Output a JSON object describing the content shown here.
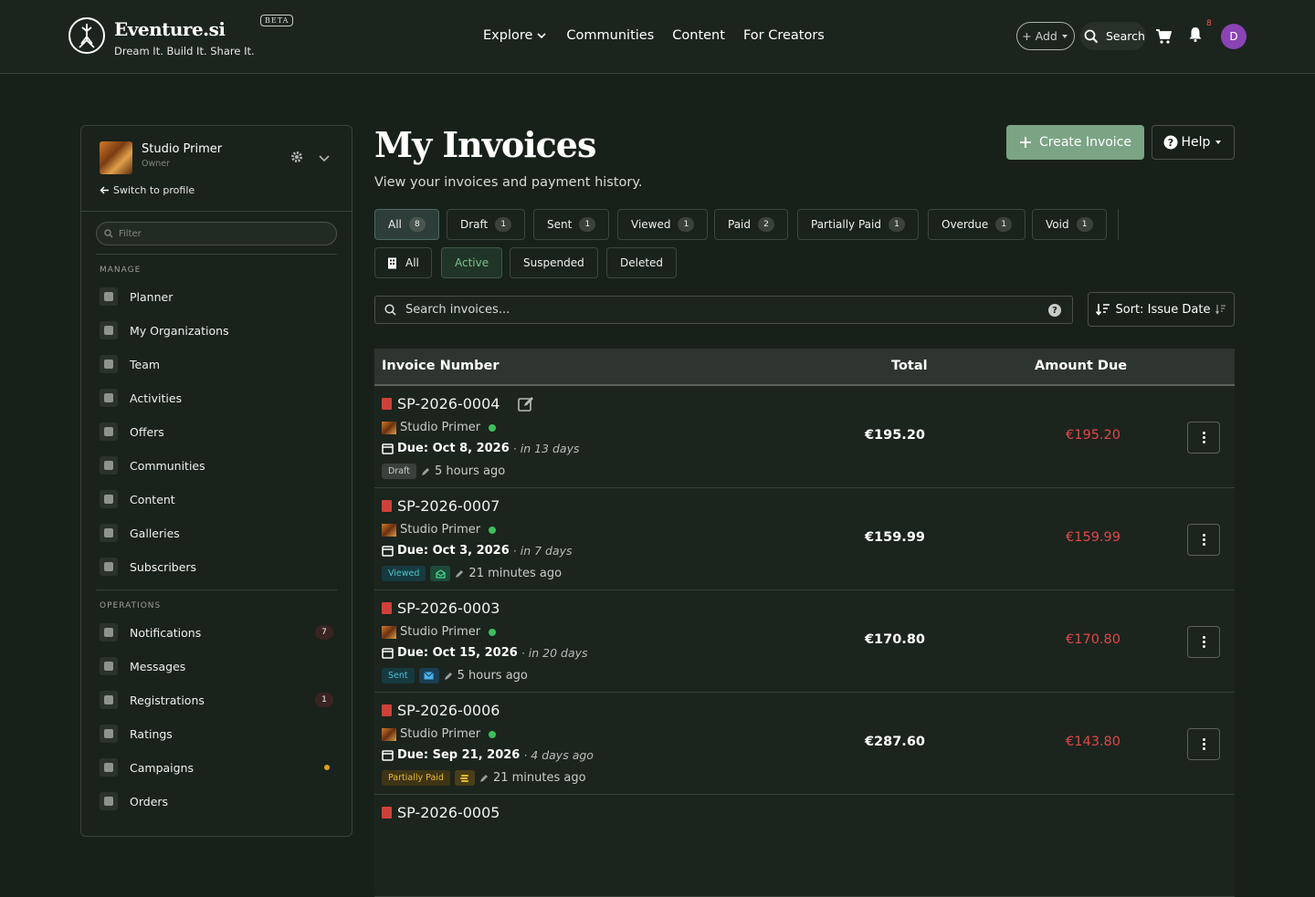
{
  "brand": {
    "name": "Eventure.si",
    "tagline": "Dream It. Build It. Share It.",
    "beta": "BETA"
  },
  "nav": {
    "items": [
      "Explore",
      "Communities",
      "Content",
      "For Creators"
    ]
  },
  "tools": {
    "add": "+ Add",
    "search": "Search",
    "notif_count": "8",
    "avatar": "D"
  },
  "sidebar": {
    "org_name": "Studio Primer",
    "org_role": "Owner",
    "switch": "Switch to profile",
    "filter_placeholder": "Filter",
    "manage_title": "MANAGE",
    "manage": [
      "Planner",
      "My Organizations",
      "Team",
      "Activities",
      "Offers",
      "Communities",
      "Content",
      "Galleries",
      "Subscribers"
    ],
    "operations_title": "OPERATIONS",
    "operations": [
      {
        "label": "Notifications",
        "badge": "7"
      },
      {
        "label": "Messages",
        "badge": ""
      },
      {
        "label": "Registrations",
        "badge": "1"
      },
      {
        "label": "Ratings",
        "badge": ""
      },
      {
        "label": "Campaigns",
        "badge": "dot"
      },
      {
        "label": "Orders",
        "badge": ""
      }
    ]
  },
  "page": {
    "title": "My Invoices",
    "subtitle": "View your invoices and payment history.",
    "create": "Create Invoice",
    "help": "Help"
  },
  "status_tabs": [
    {
      "label": "All",
      "count": "8"
    },
    {
      "label": "Draft",
      "count": "1"
    },
    {
      "label": "Sent",
      "count": "1"
    },
    {
      "label": "Viewed",
      "count": "1"
    },
    {
      "label": "Paid",
      "count": "2"
    },
    {
      "label": "Partially Paid",
      "count": "1"
    },
    {
      "label": "Overdue",
      "count": "1"
    },
    {
      "label": "Void",
      "count": "1"
    }
  ],
  "state_tabs": [
    "All",
    "Active",
    "Suspended",
    "Deleted"
  ],
  "search": {
    "placeholder": "Search invoices...",
    "help": "?"
  },
  "sort": {
    "label": "Sort: Issue Date"
  },
  "table": {
    "headers": {
      "number": "Invoice Number",
      "total": "Total",
      "due": "Amount Due"
    },
    "rows": [
      {
        "number": "SP-2026-0004",
        "org": "Studio Primer",
        "due": "Due: Oct 8, 2026",
        "rel": "· in 13 days",
        "status": "Draft",
        "edited": "5 hours ago",
        "total": "€195.20",
        "amount_due": "€195.20"
      },
      {
        "number": "SP-2026-0007",
        "org": "Studio Primer",
        "due": "Due: Oct 3, 2026",
        "rel": "· in 7 days",
        "status": "Viewed",
        "edited": "21 minutes ago",
        "total": "€159.99",
        "amount_due": "€159.99"
      },
      {
        "number": "SP-2026-0003",
        "org": "Studio Primer",
        "due": "Due: Oct 15, 2026",
        "rel": "· in 20 days",
        "status": "Sent",
        "edited": "5 hours ago",
        "total": "€170.80",
        "amount_due": "€170.80"
      },
      {
        "number": "SP-2026-0006",
        "org": "Studio Primer",
        "due": "Due: Sep 21, 2026",
        "rel": "· 4 days ago",
        "status": "Partially Paid",
        "edited": "21 minutes ago",
        "total": "€287.60",
        "amount_due": "€143.80"
      },
      {
        "number": "SP-2026-0005"
      }
    ]
  }
}
